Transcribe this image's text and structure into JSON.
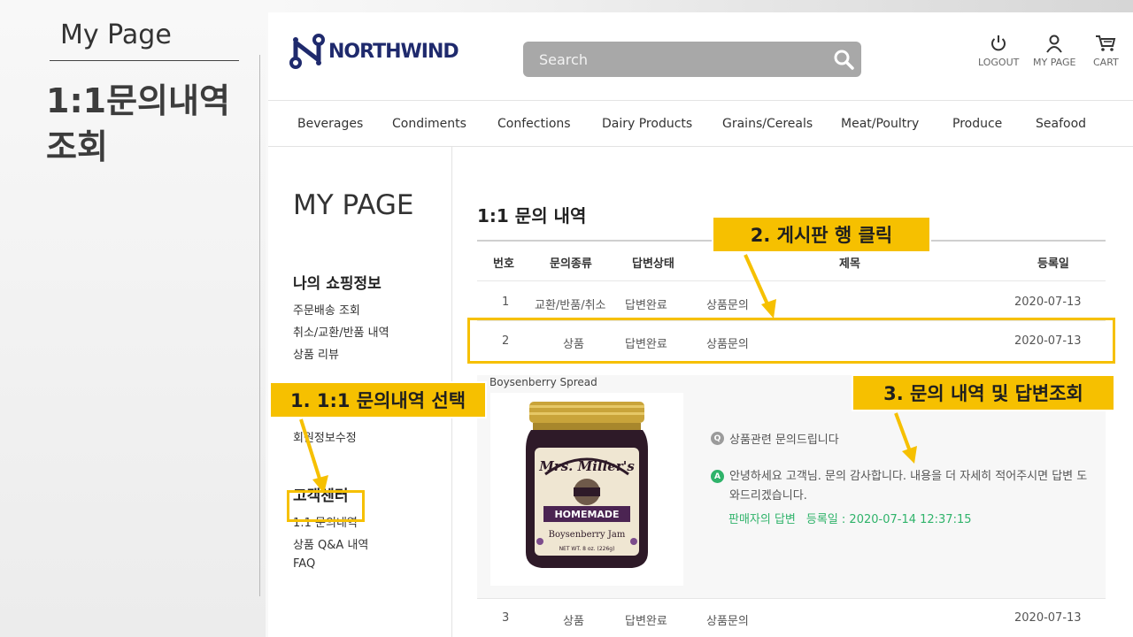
{
  "slide": {
    "title": "My Page",
    "heading": "1:1문의내역 조회"
  },
  "header": {
    "brand": "NORTHWIND",
    "search_placeholder": "Search",
    "logout_label": "LOGOUT",
    "mypage_label": "MY PAGE",
    "cart_label": "CART"
  },
  "categories": [
    "Beverages",
    "Condiments",
    "Confections",
    "Dairy Products",
    "Grains/Cereals",
    "Meat/Poultry",
    "Produce",
    "Seafood"
  ],
  "sidebar": {
    "title": "MY PAGE",
    "shopping_section": "나의 쇼핑정보",
    "shopping_links": [
      "주문배송 조회",
      "취소/교환/반품 내역",
      "상품 리뷰"
    ],
    "member_link": "회원정보수정",
    "cs_section": "고객센터",
    "cs_links": [
      "1:1 문의내역",
      "상품 Q&A 내역",
      "FAQ"
    ]
  },
  "main": {
    "title": "1:1 문의 내역",
    "columns": [
      "번호",
      "문의종류",
      "답변상태",
      "제목",
      "등록일"
    ],
    "rows": [
      {
        "no": "1",
        "type": "교환/반품/취소",
        "status": "답변완료",
        "subject": "상품문의",
        "date": "2020-07-13"
      },
      {
        "no": "2",
        "type": "상품",
        "status": "답변완료",
        "subject": "상품문의",
        "date": "2020-07-13"
      },
      {
        "no": "3",
        "type": "상품",
        "status": "답변완료",
        "subject": "상품문의",
        "date": "2020-07-13"
      }
    ],
    "detail": {
      "product_name": "Boysenberry Spread",
      "jar_brand": "Mrs. Miller's",
      "jar_banner": "HOMEMADE",
      "jar_flavor": "Boysenberry Jam",
      "jar_weight": "NET WT. 8 oz. (226g)",
      "q_badge": "Q",
      "question": "상품관련 문의드립니다",
      "a_badge": "A",
      "answer": "안녕하세요 고객님. 문의 감사합니다. 내용을 더 자세히 적어주시면 답변 도와드리겠습니다.",
      "reply_label": "판매자의 답변",
      "reply_date": "등록일 : 2020-07-14 12:37:15"
    }
  },
  "annotations": {
    "step1": "1. 1:1 문의내역 선택",
    "step2": "2. 게시판 행 클릭",
    "step3": "3. 문의 내역 및 답변조회"
  },
  "colors": {
    "callout": "#f6c000",
    "answer_green": "#2fb36a",
    "brand_navy": "#1f2a6d",
    "search_bg": "#a8a8a8"
  }
}
